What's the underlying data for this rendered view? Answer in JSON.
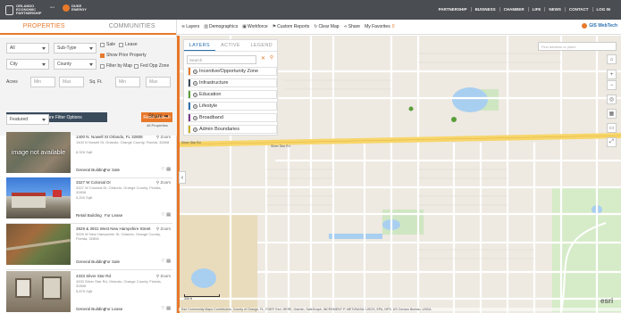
{
  "header": {
    "logo_text": "ORLANDO ECONOMIC PARTNERSHIP",
    "partner_sep": "and",
    "logo2_text": "DUKE ENERGY",
    "nav": [
      "PARTNERSHIP",
      "BUSINESS",
      "CHAMBER",
      "LIFE",
      "NEWS",
      "CONTACT",
      "LOG IN"
    ]
  },
  "left_tabs": {
    "properties": "PROPERTIES",
    "communities": "COMMUNITIES"
  },
  "filters": {
    "all": "All",
    "subtype": "Sub-Type",
    "sale": "Sale",
    "lease": "Lease",
    "show_pending": "Show Prior Property",
    "city": "City",
    "county": "County",
    "filter_by_map": "Filter by Map",
    "fed_opp_zone": "Fed Opp Zone",
    "acres_label": "Acres",
    "min1": "Min",
    "max1": "Max",
    "sqft_label": "Sq. Ft.",
    "min2": "Min",
    "max2": "Max",
    "more_btn": "Show More Filter Options",
    "reset_btn": "Reset Search",
    "sort": "Featured",
    "share": "Share",
    "count": "46 Properties"
  },
  "listings": [
    {
      "addr": "1400 N. Nowell St Orlando, FL 32808",
      "sub": "1400 N Nowell St, Orlando, Orange County, Florida, 32808",
      "size": "8,326 Sqft",
      "type": "General Building",
      "status": "For Sale",
      "thumb_text": "image not available"
    },
    {
      "addr": "3327 W Colonial Dr",
      "sub": "3327 W Colonial Dr, Orlando, Orange County, Florida, 32808",
      "size": "5,200 Sqft",
      "type": "Retail Building",
      "status": "For Lease"
    },
    {
      "addr": "3929 & 3931 West New Hampshire Street",
      "sub": "3929 W New Hampshire St, Orlando, Orange County, Florida, 32808",
      "size": "",
      "type": "General Building",
      "status": "For Sale"
    },
    {
      "addr": "4333 Silver Star Rd",
      "sub": "4333 Silver Star Rd, Orlando, Orange County, Florida, 32808",
      "size": "5,875 Sqft",
      "type": "General Building",
      "status": "For Lease"
    }
  ],
  "zoom_label": "Zoom",
  "map_toolbar": {
    "layers": "Layers",
    "demographics": "Demographics",
    "workforce": "Workforce",
    "custom_reports": "Custom Reports",
    "clear_map": "Clear Map",
    "share": "Share",
    "favorites": "My Favorites",
    "fav_count": "0",
    "gis": "GIS WebTech"
  },
  "layers_panel": {
    "tabs": [
      "LAYERS",
      "ACTIVE",
      "LEGEND"
    ],
    "search_placeholder": "Search",
    "items": [
      {
        "label": "Incentive/Opportunity Zone",
        "color": "#e8782a"
      },
      {
        "label": "Infrastructure",
        "color": "#3a4b5c"
      },
      {
        "label": "Education",
        "color": "#5a9e3a"
      },
      {
        "label": "Lifestyle",
        "color": "#2a6fb0"
      },
      {
        "label": "Broadband",
        "color": "#7a3a8e"
      },
      {
        "label": "Admin Boundaries",
        "color": "#c8b02a"
      }
    ]
  },
  "map_search_placeholder": "Find address or place",
  "map": {
    "road_main": "Silver Star Rd",
    "scale": "300 ft",
    "esri": "esri",
    "attribution": "Esri Community Maps Contributors, County of Orange, FL, FDEP, Esri, HERE, Garmin, SafeGraph, INCREMENT P, METI/NASA, USGS, EPA, NPS, US Census Bureau, USDA"
  }
}
